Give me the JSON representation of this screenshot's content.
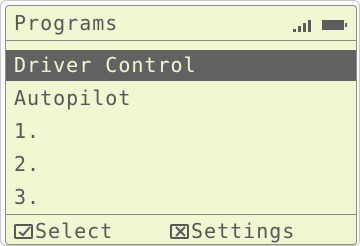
{
  "header": {
    "title": "Programs",
    "status_icons": [
      "signal-icon",
      "battery-icon"
    ]
  },
  "menu": {
    "items": [
      {
        "label": "Driver Control",
        "selected": true
      },
      {
        "label": "Autopilot",
        "selected": false
      },
      {
        "label": "1.",
        "selected": false
      },
      {
        "label": "2.",
        "selected": false
      },
      {
        "label": "3.",
        "selected": false
      }
    ]
  },
  "softkeys": {
    "left": {
      "label": "Select",
      "icon": "check-icon"
    },
    "right": {
      "label": "Settings",
      "icon": "x-icon"
    }
  },
  "colors": {
    "lcd_background": "#f3f6d2",
    "lcd_text": "#585858",
    "highlight": "#626262"
  }
}
